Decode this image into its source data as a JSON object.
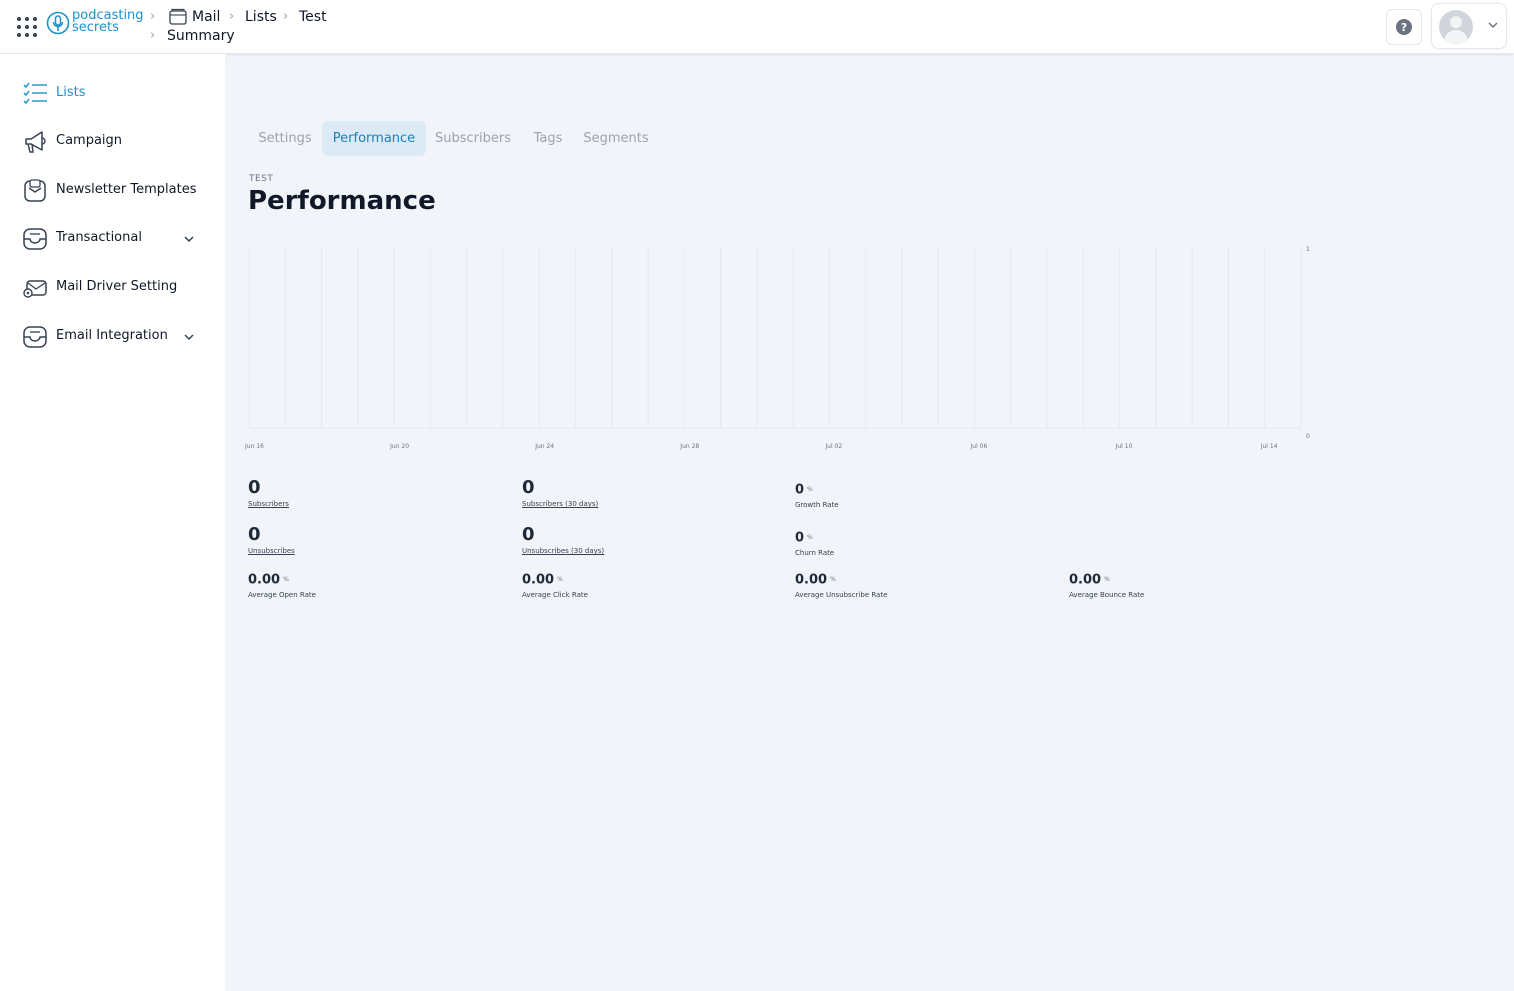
{
  "header": {
    "logo_line1": "podcasting",
    "logo_line2": "secrets",
    "breadcrumbs": [
      "Mail",
      "Lists",
      "Test",
      "Summary"
    ],
    "help_label": "?"
  },
  "sidebar": {
    "items": [
      {
        "label": "Lists",
        "icon": "checklist-icon",
        "active": true
      },
      {
        "label": "Campaign",
        "icon": "megaphone-icon"
      },
      {
        "label": "Newsletter Templates",
        "icon": "inbox-icon"
      },
      {
        "label": "Transactional",
        "icon": "tray-icon",
        "expandable": true
      },
      {
        "label": "Mail Driver Setting",
        "icon": "mail-settings-icon"
      },
      {
        "label": "Email Integration",
        "icon": "tray-icon",
        "expandable": true
      }
    ]
  },
  "tabs": [
    {
      "label": "Settings"
    },
    {
      "label": "Performance",
      "active": true
    },
    {
      "label": "Subscribers"
    },
    {
      "label": "Tags"
    },
    {
      "label": "Segments"
    }
  ],
  "page": {
    "eyebrow": "TEST",
    "title": "Performance"
  },
  "chart_data": {
    "type": "line",
    "x_tick_labels": [
      "Jun 16",
      "Jun 20",
      "Jun 24",
      "Jun 28",
      "Jul 02",
      "Jul 06",
      "Jul 10",
      "Jul 14"
    ],
    "y_tick_labels": [
      "1",
      "0"
    ],
    "ylim": [
      0,
      1
    ],
    "grid": true,
    "series": []
  },
  "stats": {
    "subscribers": {
      "value": "0",
      "label": "Subscribers"
    },
    "subscribers_30": {
      "value": "0",
      "label": "Subscribers (30 days)"
    },
    "growth_rate": {
      "value": "0",
      "unit": "%",
      "label": "Growth Rate"
    },
    "unsubscribes": {
      "value": "0",
      "label": "Unsubscribes"
    },
    "unsubscribes_30": {
      "value": "0",
      "label": "Unsubscribes (30 days)"
    },
    "churn_rate": {
      "value": "0",
      "unit": "%",
      "label": "Churn Rate"
    },
    "avg_open": {
      "value": "0.00",
      "unit": "%",
      "label": "Average Open Rate"
    },
    "avg_click": {
      "value": "0.00",
      "unit": "%",
      "label": "Average Click Rate"
    },
    "avg_unsub": {
      "value": "0.00",
      "unit": "%",
      "label": "Average Unsubscribe Rate"
    },
    "avg_bounce": {
      "value": "0.00",
      "unit": "%",
      "label": "Average Bounce Rate"
    }
  },
  "colors": {
    "accent": "#1e90c8",
    "background": "#f1f5f9",
    "active_tab_bg": "#dbeaf5"
  }
}
